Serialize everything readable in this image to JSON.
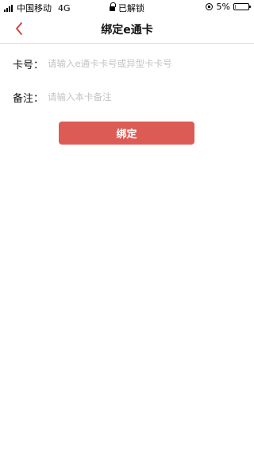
{
  "status_bar": {
    "carrier": "中国移动",
    "network": "4G",
    "lock_status": "已解锁",
    "battery_percent": "5%",
    "battery_level": 0.05,
    "battery_color": "#e53935"
  },
  "nav": {
    "title": "绑定e通卡",
    "back_icon": "chevron-left-icon",
    "accent_color": "#d0403a"
  },
  "form": {
    "card_number": {
      "label": "卡号：",
      "value": "",
      "placeholder": "请输入e通卡卡号或异型卡卡号"
    },
    "note": {
      "label": "备注：",
      "value": "",
      "placeholder": "请输入本卡备注"
    }
  },
  "actions": {
    "bind_label": "绑定",
    "bind_color": "#dd5b55"
  }
}
